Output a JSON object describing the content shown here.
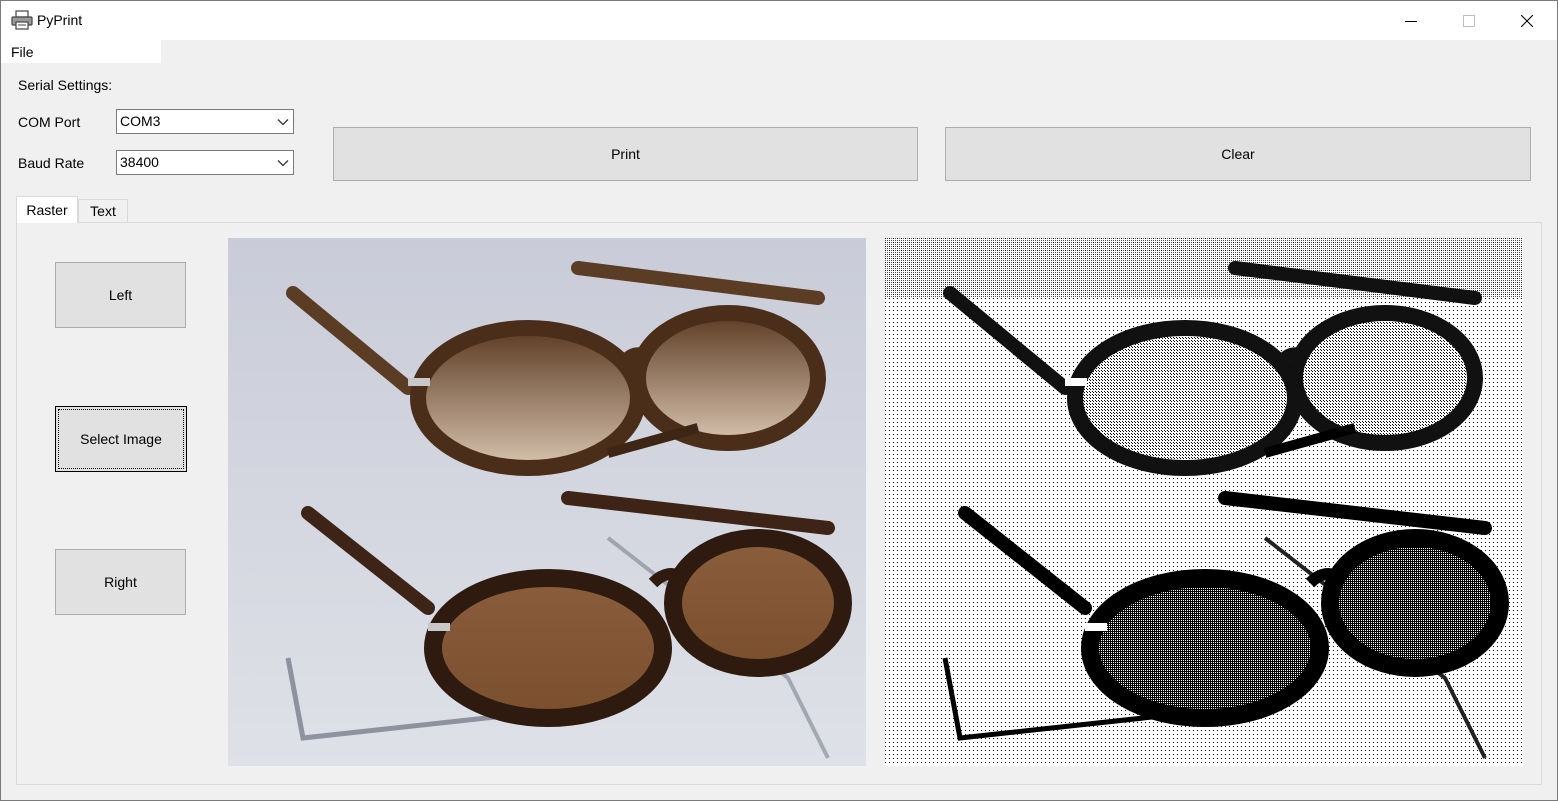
{
  "window": {
    "title": "PyPrint",
    "icon": "printer-icon"
  },
  "menu": {
    "file": "File"
  },
  "serial": {
    "heading": "Serial Settings:",
    "com_port_label": "COM Port",
    "com_port_value": "COM3",
    "baud_rate_label": "Baud Rate",
    "baud_rate_value": "38400"
  },
  "actions": {
    "print": "Print",
    "clear": "Clear"
  },
  "tabs": [
    {
      "label": "Raster",
      "active": true
    },
    {
      "label": "Text",
      "active": false
    }
  ],
  "raster": {
    "left": "Left",
    "select_image": "Select Image",
    "right": "Right"
  },
  "colors": {
    "window_bg": "#f0f0f0",
    "button_bg": "#e1e1e1",
    "button_border": "#adadad"
  }
}
